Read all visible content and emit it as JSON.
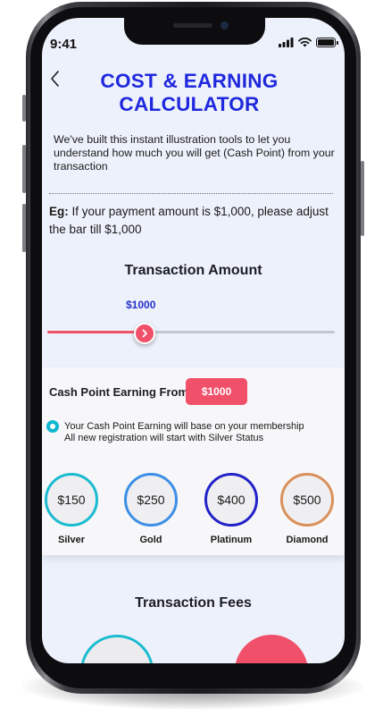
{
  "status_bar": {
    "time": "9:41"
  },
  "header": {
    "title_line1": "COST & EARNING",
    "title_line2": "CALCULATOR"
  },
  "intro_text": "We've built this instant illustration tools to let you understand how much you will get (Cash Point) from your transaction",
  "example": {
    "label": "Eg:",
    "text": " If your payment amount is $1,000, please adjust the bar till $1,000"
  },
  "transaction_amount": {
    "heading": "Transaction Amount",
    "value_label": "$1000",
    "slider_fraction": 0.34
  },
  "earning": {
    "label": "Cash Point Earning From",
    "badge": "$1000",
    "note_line1": "Your Cash Point Earning will base on your membership",
    "note_line2": "All new registration will start with Silver Status"
  },
  "tiers": [
    {
      "amount": "$150",
      "name": "Silver",
      "color": "#1bbbd0"
    },
    {
      "amount": "$250",
      "name": "Gold",
      "color": "#3d8fe6"
    },
    {
      "amount": "$400",
      "name": "Platinum",
      "color": "#2222c8"
    },
    {
      "amount": "$500",
      "name": "Diamond",
      "color": "#d9905a"
    }
  ],
  "fees": {
    "heading": "Transaction Fees"
  },
  "colors": {
    "accent": "#f0506a",
    "title": "#1f28dd",
    "screen_bg": "#edf1fb"
  }
}
